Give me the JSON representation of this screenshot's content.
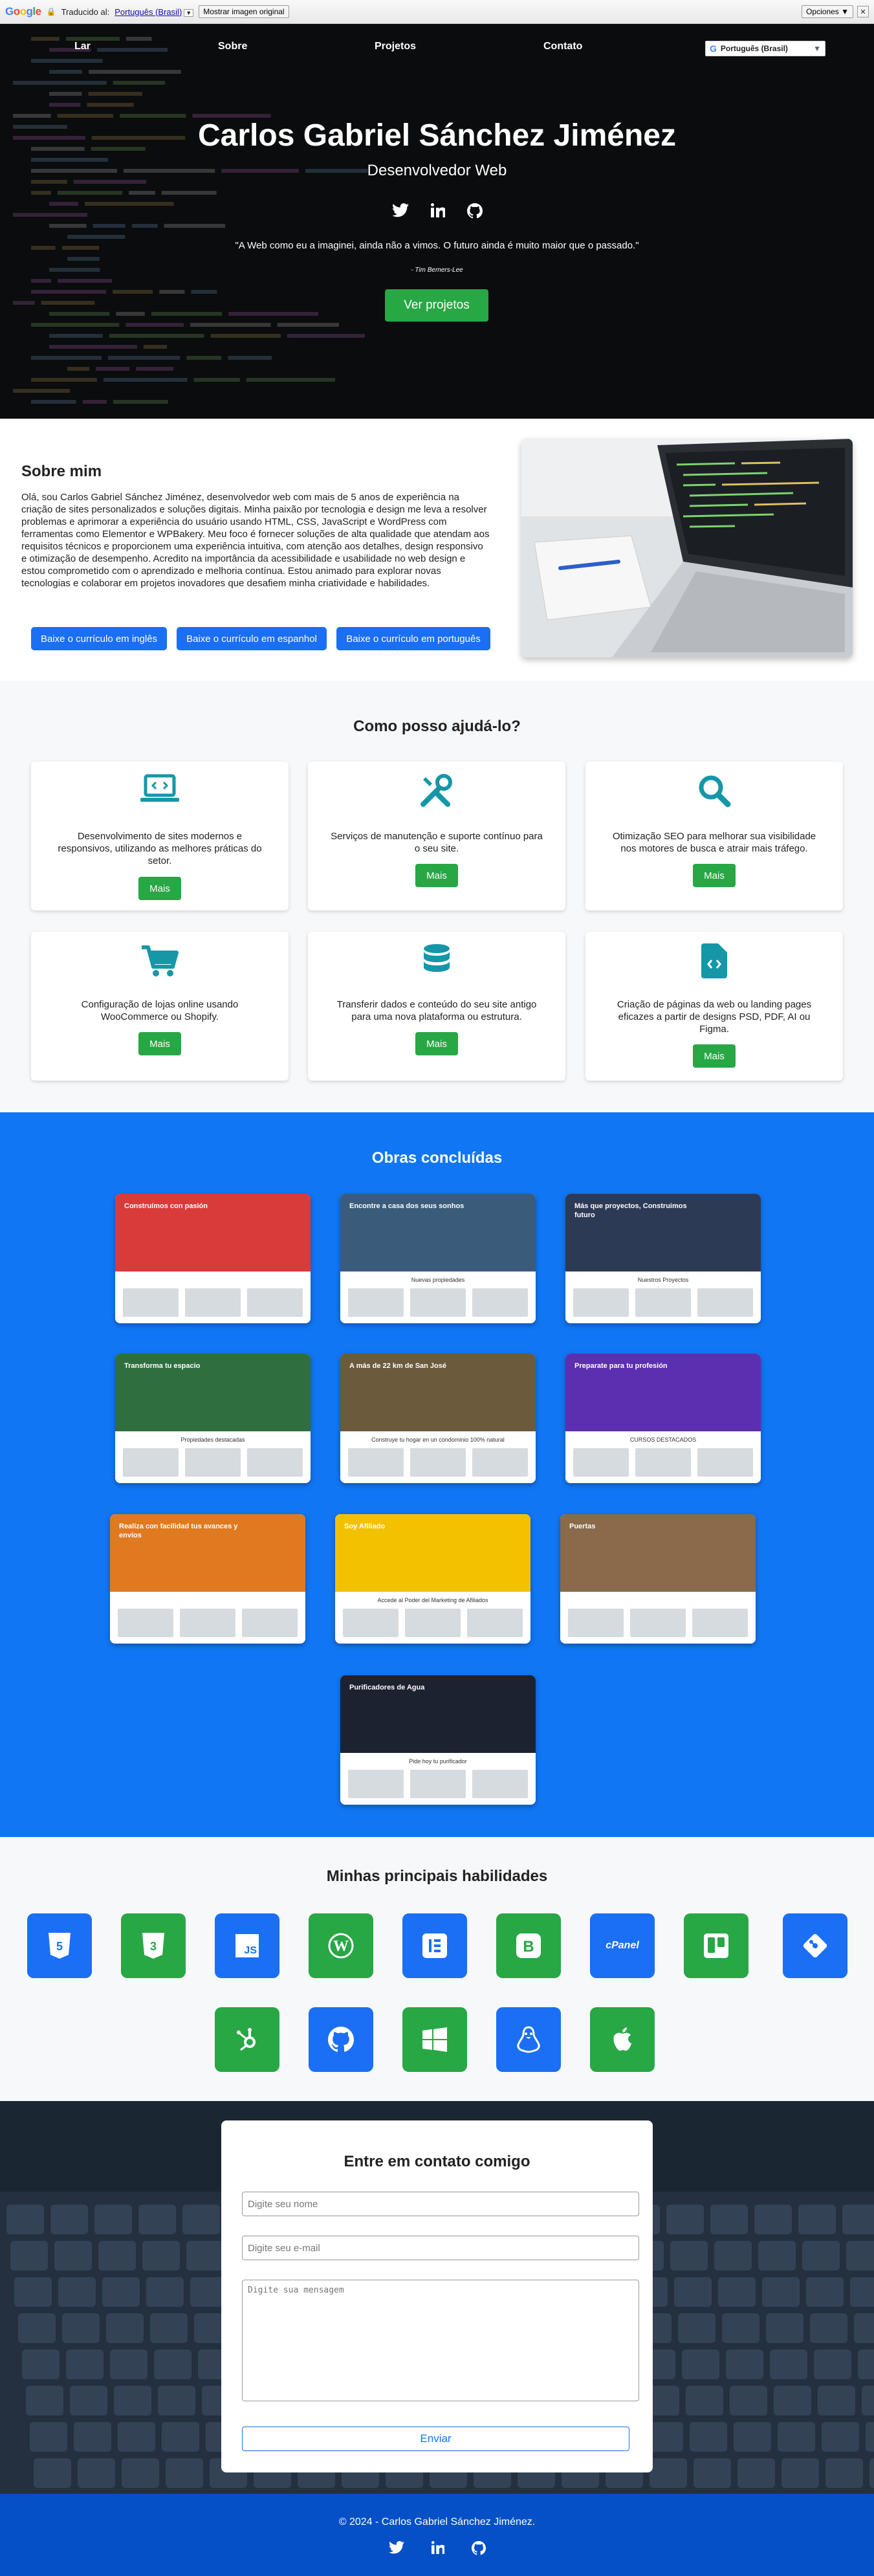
{
  "translate_bar": {
    "logo": "Google",
    "translated_to_label": "Traducido al:",
    "language": "Português (Brasil)",
    "show_original": "Mostrar imagen original",
    "options": "Opciones ▼",
    "close": "✕"
  },
  "nav": {
    "items": [
      "Lar",
      "Sobre",
      "Projetos",
      "Contato"
    ],
    "language_selector": "Português (Brasil)"
  },
  "hero": {
    "name": "Carlos Gabriel Sánchez Jiménez",
    "role": "Desenvolvedor Web",
    "quote": "\"A Web como eu a imaginei, ainda não a vimos. O futuro ainda é muito maior que o passado.\"",
    "quote_author": "- Tim Berners-Lee",
    "cta": "Ver projetos",
    "social_icons": [
      "twitter-icon",
      "linkedin-icon",
      "github-icon"
    ]
  },
  "about": {
    "title": "Sobre mim",
    "text": "Olá, sou Carlos Gabriel Sánchez Jiménez, desenvolvedor web com mais de 5 anos de experiência na criação de sites personalizados e soluções digitais. Minha paixão por tecnologia e design me leva a resolver problemas e aprimorar a experiência do usuário usando HTML, CSS, JavaScript e WordPress com ferramentas como Elementor e WPBakery. Meu foco é fornecer soluções de alta qualidade que atendam aos requisitos técnicos e proporcionem uma experiência intuitiva, com atenção aos detalhes, design responsivo e otimização de desempenho. Acredito na importância da acessibilidade e usabilidade no web design e estou comprometido com o aprendizado e melhoria contínua. Estou animado para explorar novas tecnologias e colaborar em projetos inovadores que desafiem minha criatividade e habilidades.",
    "buttons": [
      "Baixe o currículo em inglês",
      "Baixe o currículo em espanhol",
      "Baixe o currículo em português"
    ]
  },
  "services": {
    "title": "Como posso ajudá-lo?",
    "more_label": "Mais",
    "items": [
      {
        "icon": "laptop-code-icon",
        "text": "Desenvolvimento de sites modernos e responsivos, utilizando as melhores práticas do setor."
      },
      {
        "icon": "tools-icon",
        "text": "Serviços de manutenção e suporte contínuo para o seu site."
      },
      {
        "icon": "search-icon",
        "text": "Otimização SEO para melhorar sua visibilidade nos motores de busca e atrair mais tráfego."
      },
      {
        "icon": "shopping-cart-icon",
        "text": "Configuração de lojas online usando WooCommerce ou Shopify."
      },
      {
        "icon": "database-icon",
        "text": "Transferir dados e conteúdo do seu site antigo para uma nova plataforma ou estrutura."
      },
      {
        "icon": "file-code-icon",
        "text": "Criação de páginas da web ou landing pages eficazes a partir de designs PSD, PDF, AI ou Figma."
      }
    ]
  },
  "works": {
    "title": "Obras concluídas",
    "items": [
      {
        "headline": "Construímos con pasión",
        "theme": "#d93b3b"
      },
      {
        "headline": "Encontre a casa dos seus sonhos",
        "caption": "Nuevas propiedades",
        "theme": "#3b5b7a"
      },
      {
        "headline": "Más que proyectos, Construimos futuro",
        "caption": "Nuestros Proyectos",
        "theme": "#2d3a55"
      },
      {
        "headline": "Transforma tu espacio",
        "caption": "Propiedades destacadas",
        "theme": "#2f6f3f"
      },
      {
        "headline": "A más de 22 km de San José",
        "caption": "Construye tu hogar en un condominio 100% natural",
        "theme": "#6b5a3c"
      },
      {
        "headline": "Preparate para tu profesión",
        "caption": "CURSOS DESTACADOS",
        "theme": "#5b2fb0"
      },
      {
        "headline": "Realiza con facilidad tus avances y envíos",
        "theme": "#e07a20"
      },
      {
        "headline": "Soy Afiliado",
        "caption": "Accede al Poder del Marketing de Afiliados",
        "theme": "#f2c200"
      },
      {
        "headline": "Puertas",
        "theme": "#8a6a4a"
      },
      {
        "headline": "Purificadores de Agua",
        "caption": "Pide hoy tu purificador",
        "theme": "#1c2230"
      }
    ]
  },
  "skills": {
    "title": "Minhas principais habilidades",
    "items": [
      {
        "icon": "html5-icon",
        "color": "#1a6ff5"
      },
      {
        "icon": "css3-icon",
        "color": "#28a745"
      },
      {
        "icon": "javascript-icon",
        "color": "#1a6ff5"
      },
      {
        "icon": "wordpress-icon",
        "color": "#28a745"
      },
      {
        "icon": "elementor-icon",
        "color": "#1a6ff5"
      },
      {
        "icon": "bootstrap-icon",
        "color": "#28a745"
      },
      {
        "icon": "cpanel-icon",
        "color": "#1a6ff5"
      },
      {
        "icon": "trello-icon",
        "color": "#28a745"
      },
      {
        "icon": "git-icon",
        "color": "#1a6ff5"
      },
      {
        "icon": "hubspot-icon",
        "color": "#28a745"
      },
      {
        "icon": "github-icon",
        "color": "#1a6ff5"
      },
      {
        "icon": "windows-icon",
        "color": "#28a745"
      },
      {
        "icon": "linux-icon",
        "color": "#1a6ff5"
      },
      {
        "icon": "apple-icon",
        "color": "#28a745"
      }
    ],
    "labels": {
      "js": "JS",
      "cpanel": "cPanel"
    }
  },
  "contact": {
    "title": "Entre em contato comigo",
    "name_placeholder": "Digite seu nome",
    "email_placeholder": "Digite seu e-mail",
    "message_placeholder": "Digite sua mensagem",
    "send": "Enviar"
  },
  "footer": {
    "copyright": "© 2024 - Carlos Gabriel Sánchez Jiménez.",
    "social_icons": [
      "twitter-icon",
      "linkedin-icon",
      "github-icon"
    ]
  },
  "colors": {
    "primary_blue": "#1a6ff5",
    "works_bg": "#1176f3",
    "green": "#28a745",
    "teal_icons": "#1597a8",
    "footer_bg": "#0550c6"
  }
}
